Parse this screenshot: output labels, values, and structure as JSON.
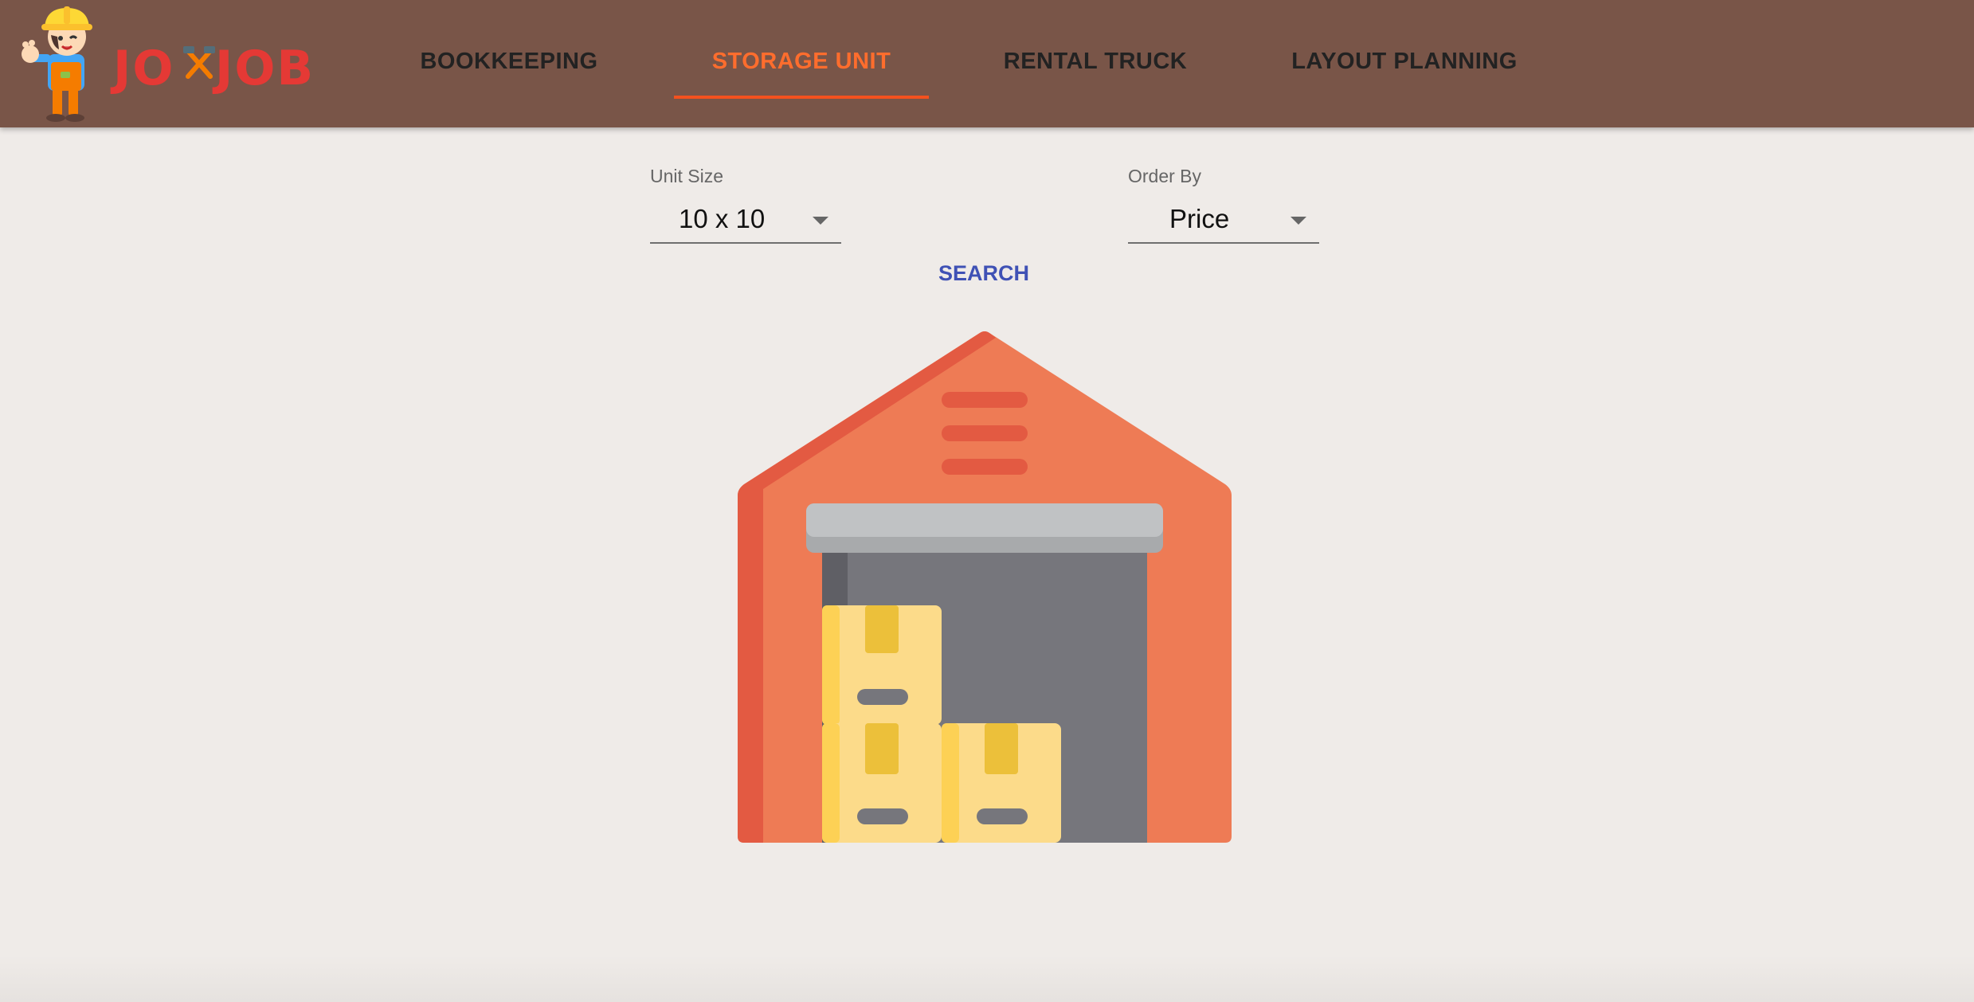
{
  "brand": {
    "logo_text": "JO JOB",
    "colors": {
      "brand_red": "#e53935",
      "appbar": "#795548"
    }
  },
  "nav": {
    "tabs": [
      {
        "label": "BOOKKEEPING",
        "active": false
      },
      {
        "label": "STORAGE UNIT",
        "active": true
      },
      {
        "label": "RENTAL TRUCK",
        "active": false
      },
      {
        "label": "LAYOUT PLANNING",
        "active": false
      }
    ],
    "active_color": "#ff6d2d"
  },
  "filters": {
    "unit_size": {
      "label": "Unit Size",
      "value": "10 x 10"
    },
    "order_by": {
      "label": "Order By",
      "value": "Price"
    },
    "search_label": "SEARCH"
  },
  "illustration": {
    "subject": "storage-unit-garage-with-boxes",
    "colors": {
      "wall": "#ee7b55",
      "wall_shade": "#e35a42",
      "door_interior": "#76767c",
      "shutter": "#c0c2c4",
      "box": "#fcdb8a",
      "box_tape": "#ecc03a"
    }
  }
}
